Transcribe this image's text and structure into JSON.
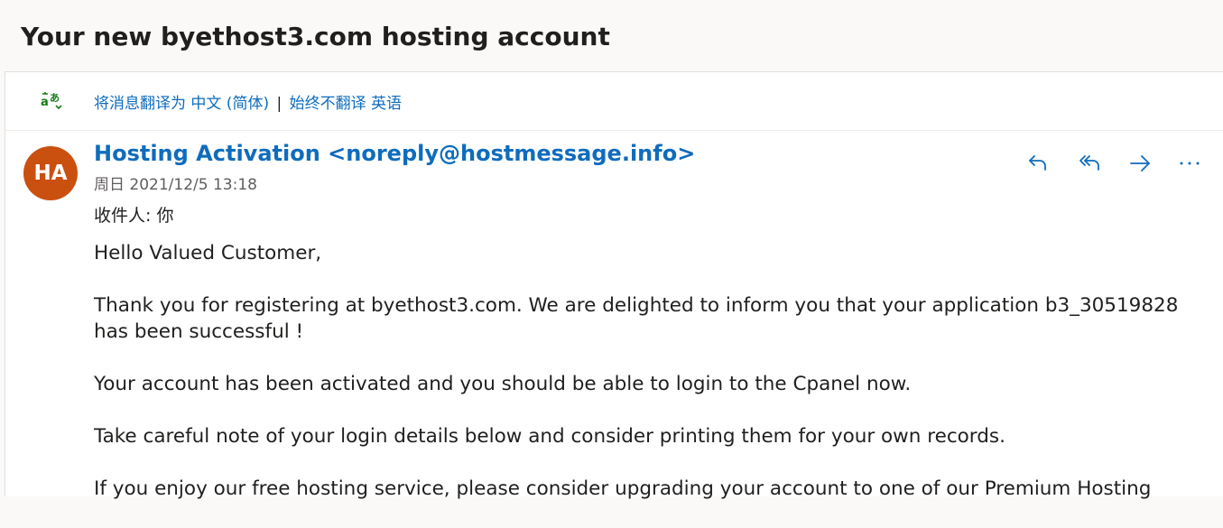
{
  "email": {
    "subject": "Your new byethost3.com hosting account",
    "translate": {
      "action_label": "将消息翻译为 中文 (简体)",
      "separator": "|",
      "never_label": "始终不翻译 英语",
      "icon": "translate-icon"
    },
    "sender": {
      "initials": "HA",
      "avatar_color": "#ca5010",
      "display": "Hosting Activation <noreply@hostmessage.info>",
      "date": "周日 2021/12/5 13:18"
    },
    "recipient_label": "收件人:",
    "recipient": "你",
    "actions": {
      "reply_icon": "reply-icon",
      "reply_all_icon": "reply-all-icon",
      "forward_icon": "forward-icon",
      "more_icon": "more-icon"
    },
    "body": [
      "Hello Valued Customer,",
      "Thank you for registering at byethost3.com. We are delighted to inform you that your application b3_30519828 has been successful !",
      "Your account has been activated and you should be able to login to the Cpanel now.",
      "Take careful note of your login details below and consider printing them for your own records.",
      "If you enjoy our free hosting service, please consider upgrading your account to one of our Premium Hosting"
    ]
  },
  "colors": {
    "accent": "#0f6cbd",
    "avatar": "#ca5010",
    "background": "#faf9f8"
  }
}
